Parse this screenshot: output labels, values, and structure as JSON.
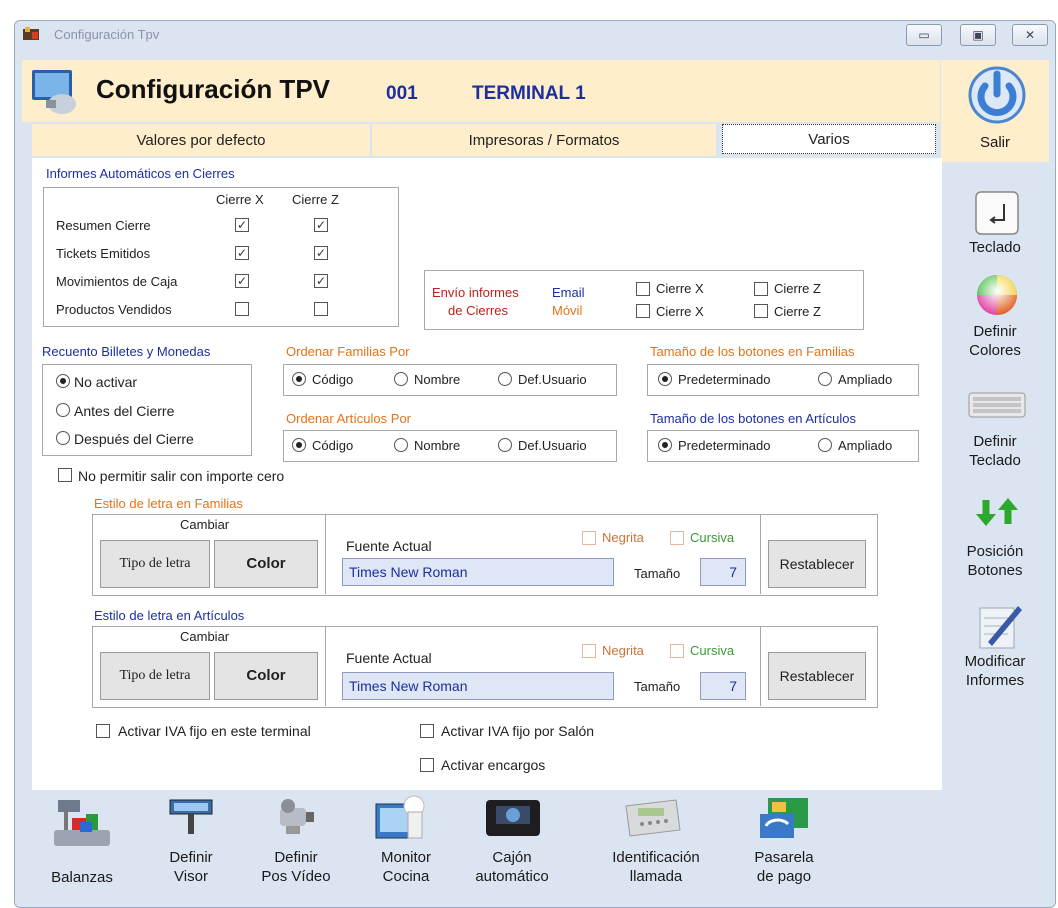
{
  "window": {
    "title": "Configuración Tpv"
  },
  "header": {
    "title": "Configuración TPV",
    "terminal_code": "001",
    "terminal_name": "TERMINAL 1"
  },
  "tabs": [
    "Valores por defecto",
    "Impresoras / Formatos",
    "Varios"
  ],
  "sidebar": {
    "salir": "Salir",
    "teclado": "Teclado",
    "definir_colores": [
      "Definir",
      "Colores"
    ],
    "definir_teclado": [
      "Definir",
      "Teclado"
    ],
    "posicion_botones": [
      "Posición",
      "Botones"
    ],
    "modificar_informes": [
      "Modificar",
      "Informes"
    ]
  },
  "informes": {
    "title": "Informes Automáticos en Cierres",
    "col_x": "Cierre X",
    "col_z": "Cierre Z",
    "rows": [
      {
        "label": "Resumen Cierre",
        "x": true,
        "z": true
      },
      {
        "label": "Tickets Emitidos",
        "x": true,
        "z": true
      },
      {
        "label": "Movimientos de Caja",
        "x": true,
        "z": true
      },
      {
        "label": "Productos Vendidos",
        "x": false,
        "z": false
      }
    ]
  },
  "envio": {
    "label_1": "Envío informes",
    "label_2": "de Cierres",
    "email": "Email",
    "movil": "Móvil",
    "cierre_x": "Cierre X",
    "cierre_z": "Cierre Z"
  },
  "recuento": {
    "title": "Recuento Billetes y Monedas",
    "options": [
      "No activar",
      "Antes del Cierre",
      "Después del Cierre"
    ],
    "selected": "No activar"
  },
  "ordenar_familias": {
    "title": "Ordenar Familias Por",
    "options": [
      "Código",
      "Nombre",
      "Def.Usuario"
    ],
    "selected": "Código"
  },
  "ordenar_articulos": {
    "title": "Ordenar Artículos Por",
    "options": [
      "Código",
      "Nombre",
      "Def.Usuario"
    ],
    "selected": "Código"
  },
  "tam_familias": {
    "title": "Tamaño de los botones en Familias",
    "options": [
      "Predeterminado",
      "Ampliado"
    ],
    "selected": "Predeterminado"
  },
  "tam_articulos": {
    "title": "Tamaño de los botones en Artículos",
    "options": [
      "Predeterminado",
      "Ampliado"
    ],
    "selected": "Predeterminado"
  },
  "no_permitir": {
    "label": "No permitir salir con importe cero",
    "checked": false
  },
  "estilo_familias": {
    "title": "Estilo de letra en Familias",
    "cambiar": "Cambiar",
    "tipo": "Tipo de letra",
    "color": "Color",
    "fuente_label": "Fuente Actual",
    "fuente": "Times New Roman",
    "negrita": "Negrita",
    "cursiva": "Cursiva",
    "tamano_label": "Tamaño",
    "tamano": "7",
    "restablecer": "Restablecer"
  },
  "estilo_articulos": {
    "title": "Estilo de letra en Artículos",
    "cambiar": "Cambiar",
    "tipo": "Tipo de letra",
    "color": "Color",
    "fuente_label": "Fuente Actual",
    "fuente": "Times New Roman",
    "negrita": "Negrita",
    "cursiva": "Cursiva",
    "tamano_label": "Tamaño",
    "tamano": "7",
    "restablecer": "Restablecer"
  },
  "iva_terminal": "Activar IVA fijo en este terminal",
  "iva_salon": "Activar IVA fijo por Salón",
  "encargos": "Activar encargos",
  "bottom": [
    {
      "l1": "",
      "l2": "Balanzas"
    },
    {
      "l1": "Definir",
      "l2": "Visor"
    },
    {
      "l1": "Definir",
      "l2": "Pos Vídeo"
    },
    {
      "l1": "Monitor",
      "l2": "Cocina"
    },
    {
      "l1": "Cajón",
      "l2": "automático"
    },
    {
      "l1": "Identificación",
      "l2": "llamada"
    },
    {
      "l1": "Pasarela",
      "l2": "de pago"
    }
  ],
  "colors": {
    "header_bg": "#ffeecb",
    "frame_bg": "#dbe5f1",
    "accent_blue": "#1c2fa0",
    "accent_orange": "#e2731b"
  }
}
